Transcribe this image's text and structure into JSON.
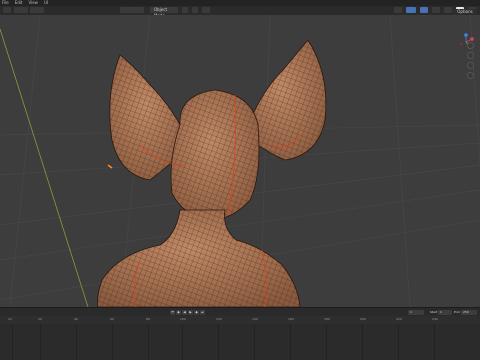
{
  "menu": [
    "File",
    "Edit",
    "View",
    "UI"
  ],
  "header": {
    "mode": "Object Mode",
    "options": "Options"
  },
  "timeline": {
    "ruler_labels": [
      "12",
      "20",
      "40",
      "60",
      "80",
      "100",
      "120",
      "140",
      "160",
      "180",
      "200",
      "220",
      "240"
    ],
    "controls": {
      "start": "Start",
      "start_value": "1",
      "end": "End",
      "end_value": "250",
      "current": "1"
    }
  },
  "colors": {
    "accent": "#4772b3",
    "seam": "#e04020",
    "skin": "#b07a5a"
  }
}
